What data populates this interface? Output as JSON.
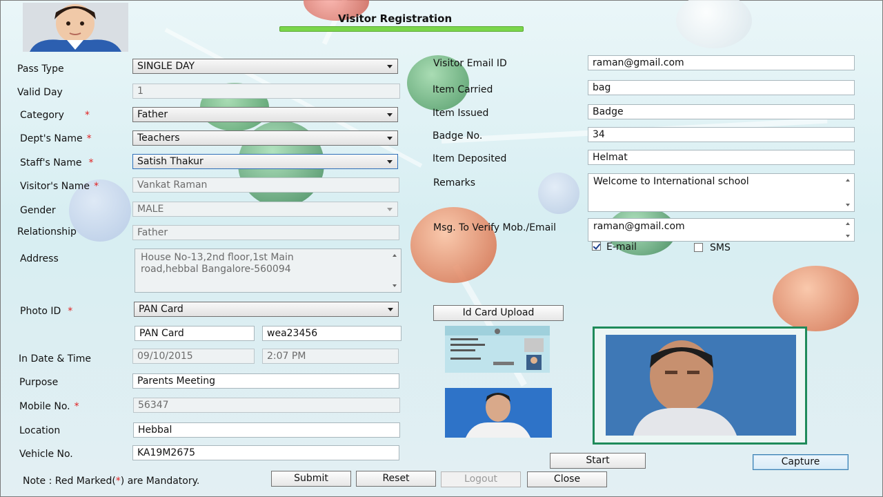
{
  "window": {
    "title": "Visitor Registration"
  },
  "left_form": {
    "pass_type": {
      "label": "Pass Type",
      "value": "SINGLE DAY"
    },
    "valid_day": {
      "label": "Valid Day",
      "value": "1"
    },
    "category": {
      "label": "Category",
      "value": "Father"
    },
    "dept_name": {
      "label": "Dept's Name",
      "value": "Teachers"
    },
    "staff_name": {
      "label": "Staff's Name",
      "value": "Satish Thakur"
    },
    "visitor_name": {
      "label": "Visitor's Name",
      "value": "Vankat Raman"
    },
    "gender": {
      "label": "Gender",
      "value": "MALE"
    },
    "relationship": {
      "label": "Relationship",
      "value": "Father"
    },
    "address": {
      "label": "Address",
      "value": "House No-13,2nd floor,1st Main road,hebbal Bangalore-560094"
    },
    "photo_id": {
      "label": "Photo ID",
      "value": "PAN Card",
      "id_type": "PAN Card",
      "id_number": "wea23456"
    },
    "in_date_time": {
      "label": "In Date & Time",
      "date": "09/10/2015",
      "time": "2:07 PM"
    },
    "purpose": {
      "label": "Purpose",
      "value": "Parents Meeting"
    },
    "mobile": {
      "label": "Mobile No.",
      "value": "56347"
    },
    "location": {
      "label": "Location",
      "value": "Hebbal"
    },
    "vehicle": {
      "label": "Vehicle No.",
      "value": "KA19M2675"
    },
    "required_mark": "*"
  },
  "right_form": {
    "email": {
      "label": "Visitor Email ID",
      "value": "raman@gmail.com"
    },
    "item_carried": {
      "label": "Item Carried",
      "value": "bag"
    },
    "item_issued": {
      "label": "Item Issued",
      "value": "Badge"
    },
    "badge_no": {
      "label": "Badge No.",
      "value": "34"
    },
    "item_deposited": {
      "label": "Item Deposited",
      "value": "Helmat"
    },
    "remarks": {
      "label": "Remarks",
      "value": "Welcome to International school"
    },
    "verify": {
      "label": "Msg. To Verify Mob./Email",
      "value": "raman@gmail.com"
    },
    "email_check": {
      "label": "E-mail",
      "checked": true
    },
    "sms_check": {
      "label": "SMS",
      "checked": false
    }
  },
  "buttons": {
    "id_card_upload": "Id Card Upload",
    "start": "Start",
    "capture": "Capture",
    "submit": "Submit",
    "reset": "Reset",
    "logout": "Logout",
    "close": "Close"
  },
  "note": {
    "prefix": "Note : Red Marked(",
    "mark": "*",
    "suffix": ") are Mandatory."
  },
  "icons": [
    "dropdown-arrow-icon",
    "scroll-up-icon",
    "scroll-down-icon",
    "checkmark-icon"
  ],
  "colors": {
    "required": "#e02020",
    "title_bar": "#7ad64a",
    "photo_frame": "#1f8a5a"
  }
}
